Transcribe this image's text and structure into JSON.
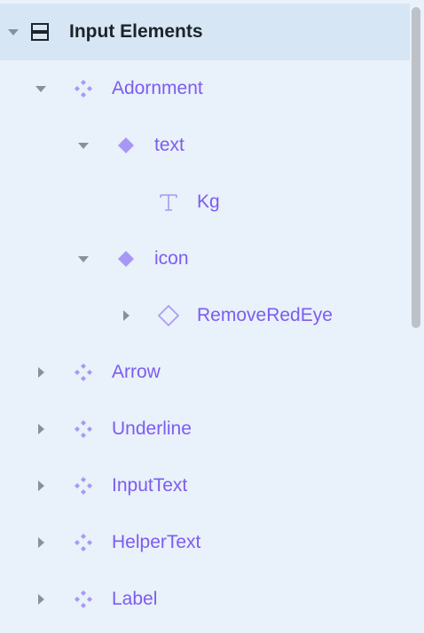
{
  "tree": {
    "root": {
      "label": "Input Elements",
      "icon": "layout-rows-icon",
      "expanded": true
    },
    "items": [
      {
        "label": "Adornment",
        "icon": "component-icon",
        "expanded": true
      },
      {
        "label": "text",
        "icon": "diamond-filled-icon",
        "expanded": true
      },
      {
        "label": "Kg",
        "icon": "text-icon"
      },
      {
        "label": "icon",
        "icon": "diamond-filled-icon",
        "expanded": true
      },
      {
        "label": "RemoveRedEye",
        "icon": "diamond-outline-icon",
        "expanded": false
      },
      {
        "label": "Arrow",
        "icon": "component-icon",
        "expanded": false
      },
      {
        "label": "Underline",
        "icon": "component-icon",
        "expanded": false
      },
      {
        "label": "InputText",
        "icon": "component-icon",
        "expanded": false
      },
      {
        "label": "HelperText",
        "icon": "component-icon",
        "expanded": false
      },
      {
        "label": "Label",
        "icon": "component-icon",
        "expanded": false
      }
    ]
  },
  "colors": {
    "background": "#e9f1fa",
    "selected_row": "#d6e6f4",
    "accent_purple": "#7c5cf0",
    "icon_purple": "#a898f5",
    "caret": "#8c9096"
  }
}
